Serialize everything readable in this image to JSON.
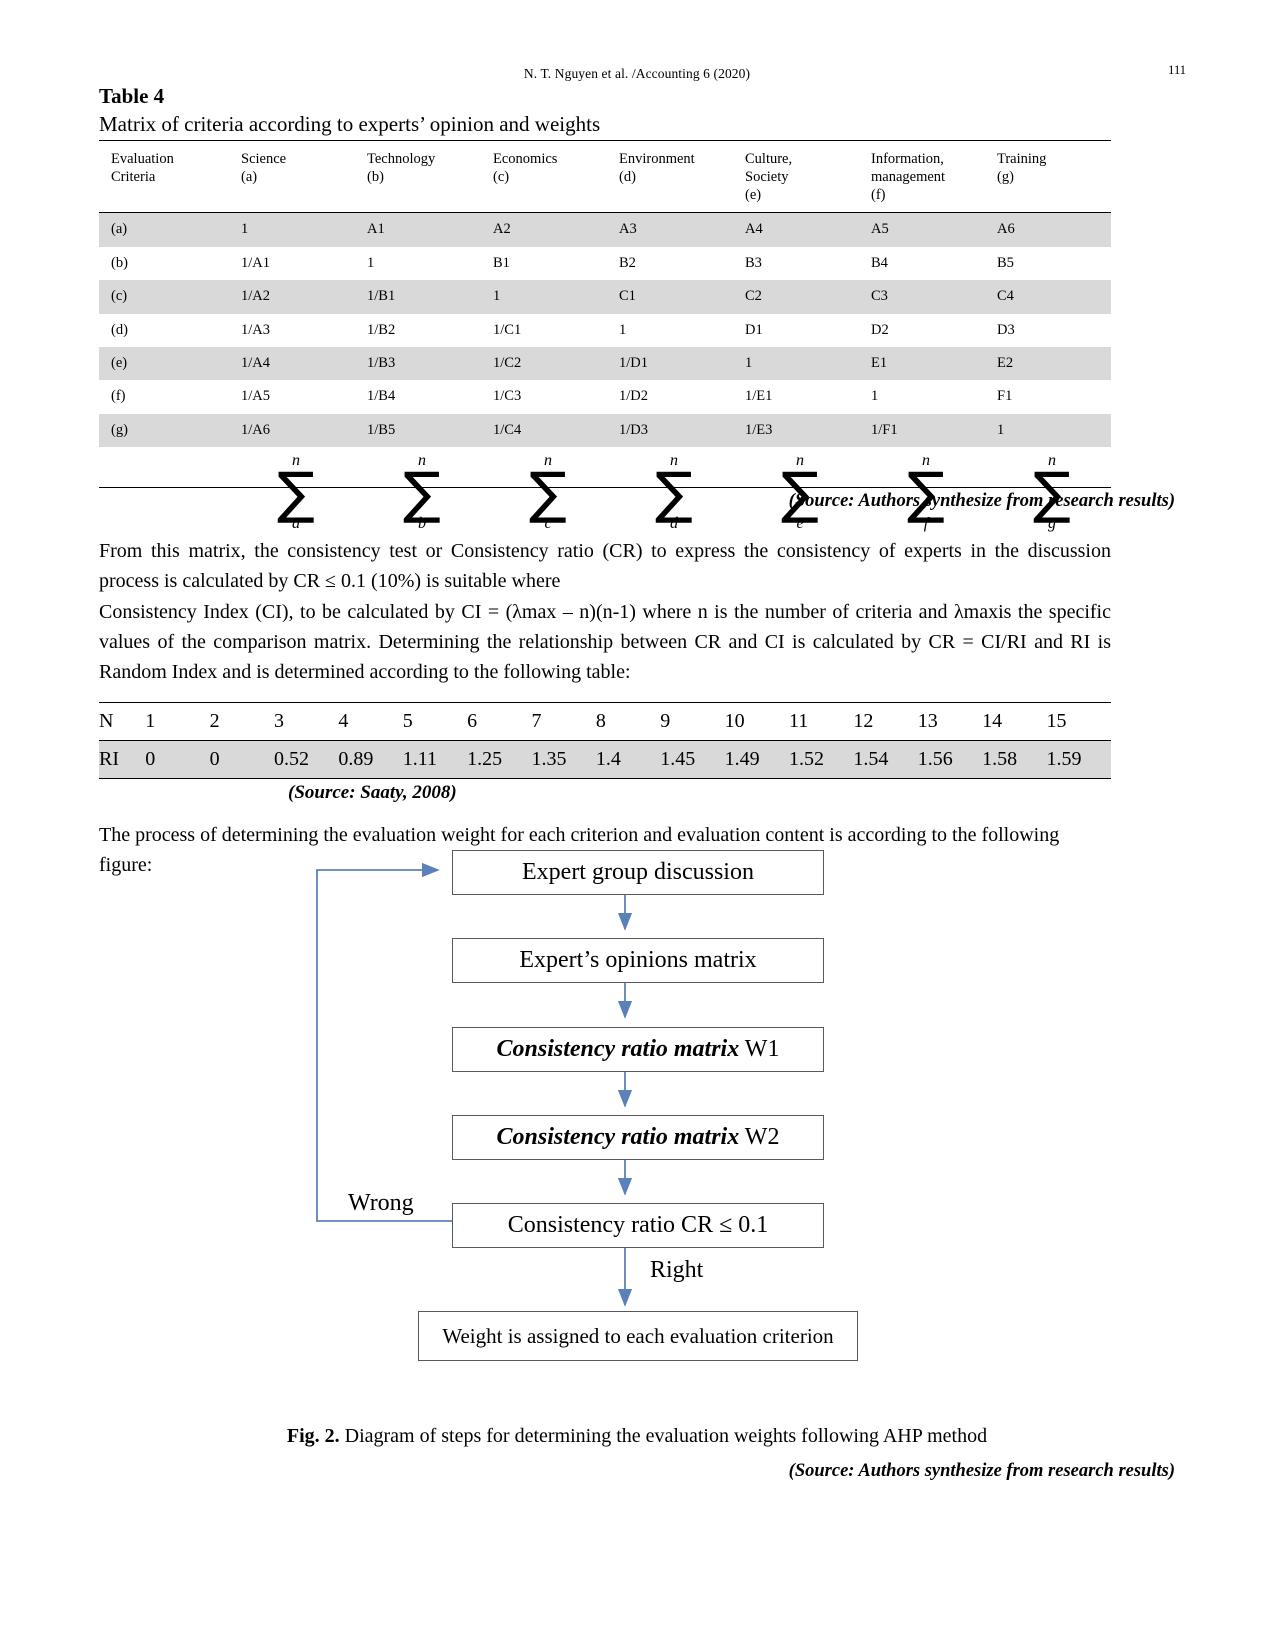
{
  "runhead": {
    "text": "N. T. Nguyen et al. /Accounting 6 (2020)",
    "page_number": "111"
  },
  "table4": {
    "label": "Table 4",
    "caption": "Matrix of criteria according to experts’ opinion and weights",
    "headers": [
      {
        "line1": "Evaluation",
        "line2": "Criteria",
        "line3": ""
      },
      {
        "line1": "Science",
        "line2": "(a)",
        "line3": ""
      },
      {
        "line1": "Technology",
        "line2": "(b)",
        "line3": ""
      },
      {
        "line1": "Economics",
        "line2": "(c)",
        "line3": ""
      },
      {
        "line1": "Environment",
        "line2": "(d)",
        "line3": ""
      },
      {
        "line1": "Culture,",
        "line2": "Society",
        "line3": "(e)"
      },
      {
        "line1": "Information,",
        "line2": "management",
        "line3": "(f)"
      },
      {
        "line1": "Training",
        "line2": "(g)",
        "line3": ""
      }
    ],
    "rows": [
      {
        "label": "(a)",
        "cells": [
          "1",
          "A1",
          "A2",
          "A3",
          "A4",
          "A5",
          "A6"
        ]
      },
      {
        "label": "(b)",
        "cells": [
          "1/A1",
          "1",
          "B1",
          "B2",
          "B3",
          "B4",
          "B5"
        ]
      },
      {
        "label": "(c)",
        "cells": [
          "1/A2",
          "1/B1",
          "1",
          "C1",
          "C2",
          "C3",
          "C4"
        ]
      },
      {
        "label": "(d)",
        "cells": [
          "1/A3",
          "1/B2",
          "1/C1",
          "1",
          "D1",
          "D2",
          "D3"
        ]
      },
      {
        "label": "(e)",
        "cells": [
          "1/A4",
          "1/B3",
          "1/C2",
          "1/D1",
          "1",
          "E1",
          "E2"
        ]
      },
      {
        "label": "(f)",
        "cells": [
          "1/A5",
          "1/B4",
          "1/C3",
          "1/D2",
          "1/E1",
          "1",
          "F1"
        ]
      },
      {
        "label": "(g)",
        "cells": [
          "1/A6",
          "1/B5",
          "1/C4",
          "1/D3",
          "1/E3",
          "1/F1",
          "1"
        ]
      }
    ],
    "sum_row": {
      "upper": "n",
      "glyph": "∑",
      "subscripts": [
        "a",
        "b",
        "c",
        "d",
        "e",
        "f",
        "g"
      ]
    },
    "source": "(Source: Authors synthesize from research results)"
  },
  "paragraphs": {
    "p1": "From this matrix, the consistency test or Consistency ratio (CR) to express the consistency of experts in the discussion process is calculated by  CR ≤  0.1 (10%) is suitable where",
    "p2": "Consistency Index (CI), to be calculated by CI = (λmax – n)(n-1) where n is the number of criteria and λmaxis the specific values of the comparison matrix. Determining the relationship between CR and CI is calculated by CR = CI/RI and RI is Random Index and is determined according to the following table:",
    "p3": "The process of determining the  evaluation weight for each criterion and evaluation content is according to the following figure:"
  },
  "ri_table": {
    "row_labels": [
      "N",
      "RI"
    ],
    "n_values": [
      "1",
      "2",
      "3",
      "4",
      "5",
      "6",
      "7",
      "8",
      "9",
      "10",
      "11",
      "12",
      "13",
      "14",
      "15"
    ],
    "ri_values": [
      "0",
      "0",
      "0.52",
      "0.89",
      "1.11",
      "1.25",
      "1.35",
      "1.4",
      "1.45",
      "1.49",
      "1.52",
      "1.54",
      "1.56",
      "1.58",
      "1.59"
    ],
    "source": "(Source: Saaty, 2008)"
  },
  "flowchart": {
    "accent_color": "#5B82B8",
    "box_border_color": "#595959",
    "boxes": [
      {
        "id": "expert-group-discussion",
        "text": "Expert group discussion"
      },
      {
        "id": "experts-opinions-matrix",
        "text": "Expert’s opinions matrix"
      },
      {
        "id": "consistency-ratio-matrix-w1",
        "bold_italic": "Consistency ratio matrix",
        "plain": " W1"
      },
      {
        "id": "consistency-ratio-matrix-w2",
        "bold_italic": "Consistency ratio matrix",
        "plain": " W2"
      },
      {
        "id": "consistency-ratio-cr",
        "text": "Consistency ratio CR ≤ 0.1"
      },
      {
        "id": "weight-assigned",
        "text": "Weight is assigned to each evaluation criterion"
      }
    ],
    "labels": {
      "wrong": "Wrong",
      "right": "Right"
    }
  },
  "figure": {
    "number": "Fig. 2.",
    "caption": " Diagram of steps for determining the evaluation weights following AHP method",
    "source": "(Source: Authors synthesize from research results)"
  }
}
